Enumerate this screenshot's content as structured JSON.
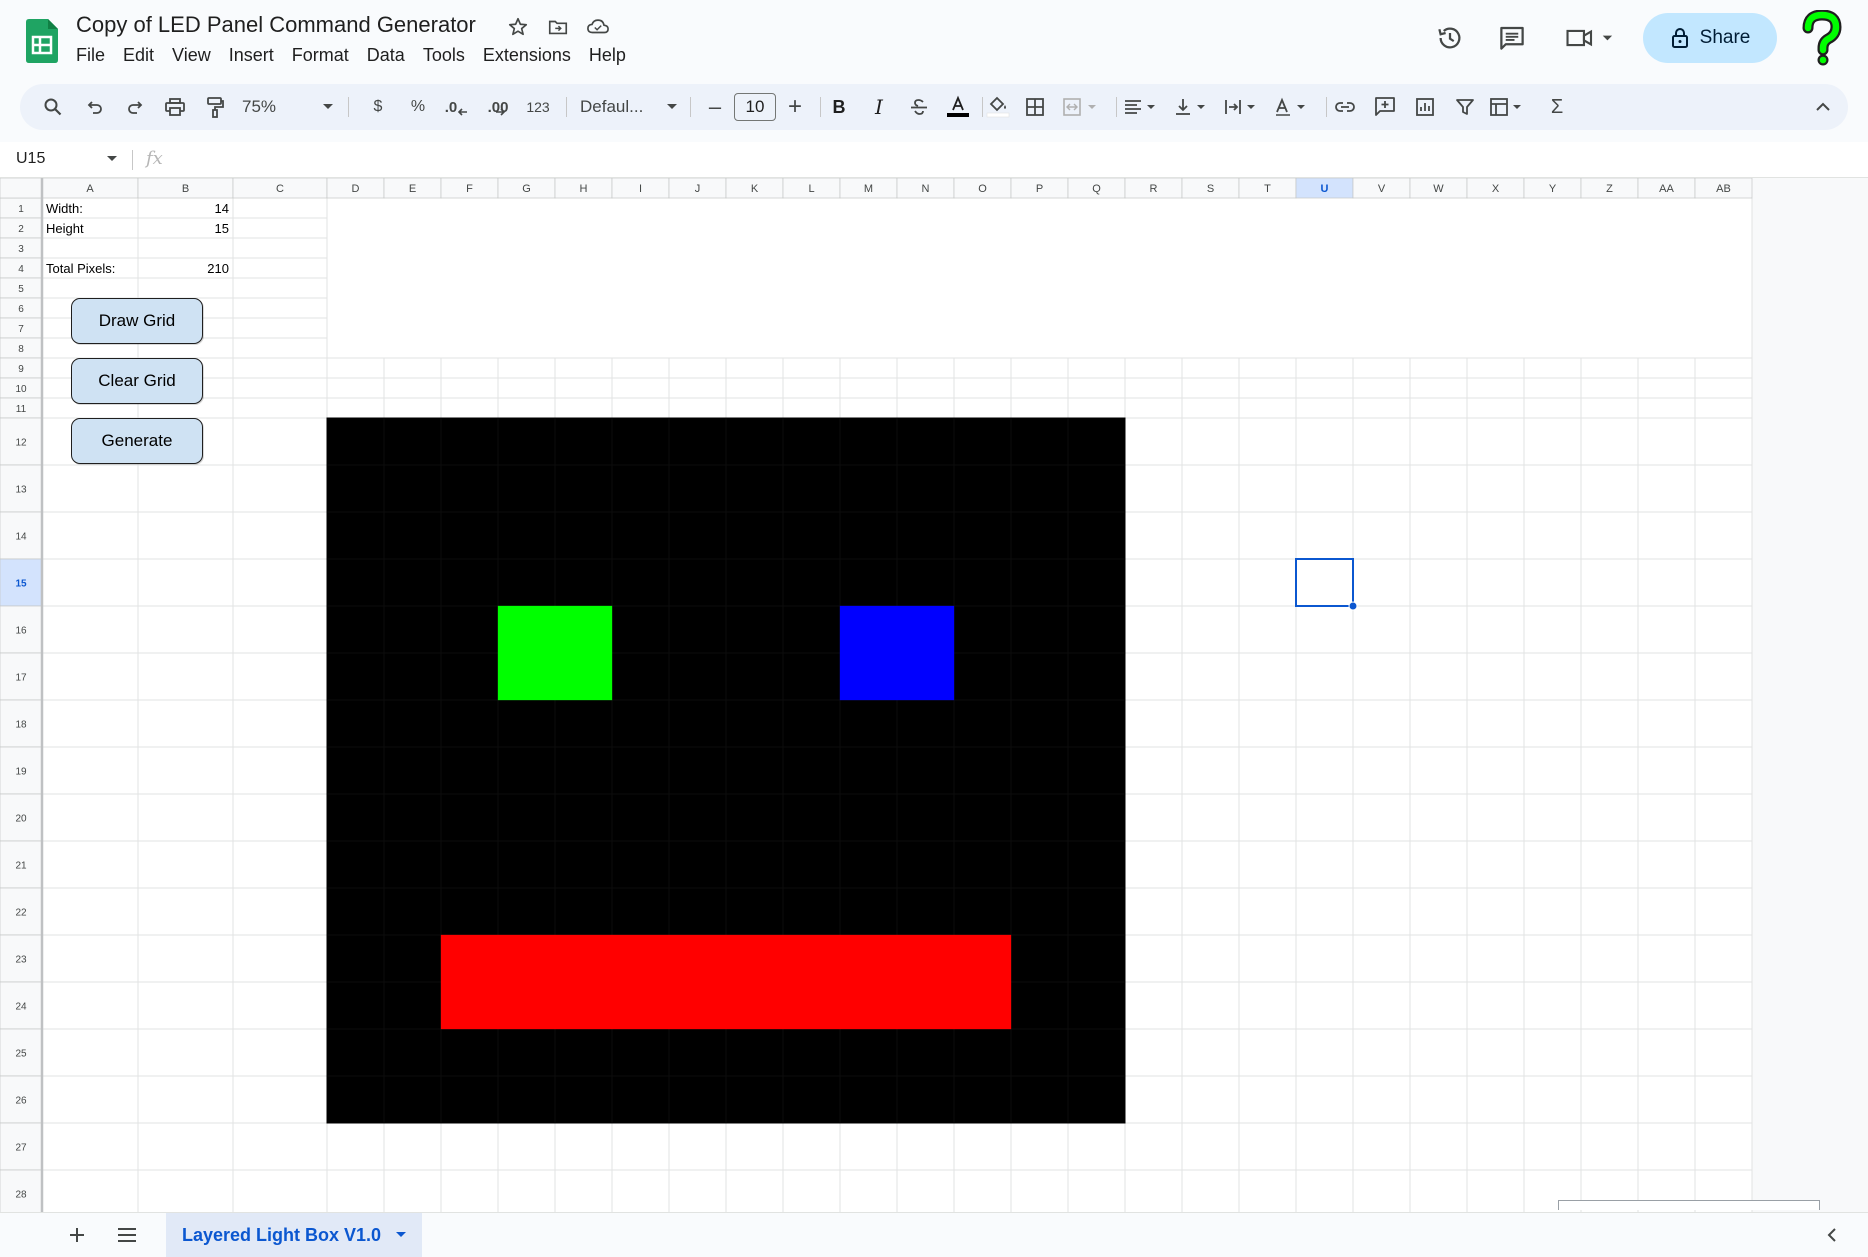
{
  "app": {
    "doc_title": "Copy of LED Panel Command Generator",
    "menus": [
      "File",
      "Edit",
      "View",
      "Insert",
      "Format",
      "Data",
      "Tools",
      "Extensions",
      "Help"
    ],
    "share_label": "Share",
    "icons": {
      "logo": "google-sheets-logo",
      "star": "star-icon",
      "move": "move-to-folder-icon",
      "cloud": "cloud-saved-icon",
      "history": "version-history-icon",
      "comments": "comments-icon",
      "meet": "video-call-icon",
      "lock": "lock-icon",
      "help": "help-question-icon"
    },
    "accent": "#0b57d0",
    "share_bg": "#c2e7ff",
    "help_color": "#00ff00"
  },
  "toolbar": {
    "zoom": "75%",
    "currency": "$",
    "percent": "%",
    "decrease_decimal": ".0",
    "increase_decimal": ".00",
    "number_format": "123",
    "font": "Defaul...",
    "font_size": "10",
    "minus": "–",
    "plus": "+",
    "bold": "B",
    "italic": "I",
    "sigma": "Σ"
  },
  "formula_bar": {
    "name_box": "U15",
    "fx": "fx"
  },
  "grid": {
    "columns": [
      "A",
      "B",
      "C",
      "D",
      "E",
      "F",
      "G",
      "H",
      "I",
      "J",
      "K",
      "L",
      "M",
      "N",
      "O",
      "P",
      "Q",
      "R",
      "S",
      "T",
      "U",
      "V",
      "W",
      "X",
      "Y",
      "Z",
      "AA",
      "AB"
    ],
    "rows": [
      "1",
      "2",
      "3",
      "4",
      "5",
      "6",
      "7",
      "8",
      "9",
      "10",
      "11",
      "12",
      "13",
      "14",
      "15",
      "16",
      "17",
      "18",
      "19",
      "20",
      "21",
      "22",
      "23",
      "24",
      "25",
      "26",
      "27",
      "28"
    ],
    "selected_cell": "U15",
    "selected_column": "U",
    "selected_row": "15",
    "cells": {
      "A1": "Width:",
      "B1": "14",
      "A2": "Height",
      "B2": "15",
      "A4": "Total Pixels:",
      "B4": "210"
    },
    "panel": {
      "first_column": "D",
      "first_row": "12",
      "width": 14,
      "height": 15,
      "background": "#000000",
      "colored_blocks": [
        {
          "color": "#00ff00",
          "columns": [
            "G",
            "H"
          ],
          "rows": [
            "16",
            "17"
          ]
        },
        {
          "color": "#0000ff",
          "columns": [
            "M",
            "N"
          ],
          "rows": [
            "16",
            "17"
          ]
        },
        {
          "color": "#ff0000",
          "columns": [
            "F",
            "G",
            "H",
            "I",
            "J",
            "K",
            "L",
            "M",
            "N",
            "O"
          ],
          "rows": [
            "23",
            "24"
          ]
        }
      ]
    }
  },
  "buttons": {
    "draw_grid": "Draw Grid",
    "clear_grid": "Clear Grid",
    "generate": "Generate"
  },
  "sheets": {
    "active_tab": "Layered Light Box V1.0",
    "add_icon": "add-sheet-icon",
    "list_icon": "all-sheets-icon"
  }
}
